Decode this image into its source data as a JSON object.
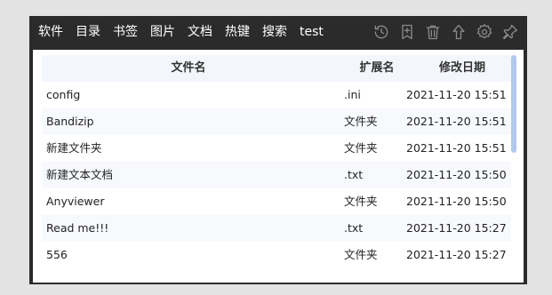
{
  "menu": {
    "items": [
      {
        "label": "软件"
      },
      {
        "label": "目录"
      },
      {
        "label": "书签"
      },
      {
        "label": "图片"
      },
      {
        "label": "文档"
      },
      {
        "label": "热键"
      },
      {
        "label": "搜索"
      },
      {
        "label": "test"
      }
    ]
  },
  "toolbar": {
    "icons": [
      "history-icon",
      "bookmark-add-icon",
      "trash-icon",
      "up-arrow-icon",
      "gear-icon",
      "pin-icon"
    ],
    "icon_color": "#8a8a8a"
  },
  "table": {
    "headers": {
      "name": "文件名",
      "ext": "扩展名",
      "date": "修改日期"
    },
    "rows": [
      {
        "name": "config",
        "ext": ".ini",
        "date": "2021-11-20 15:51"
      },
      {
        "name": "Bandizip",
        "ext": "文件夹",
        "date": "2021-11-20 15:51"
      },
      {
        "name": "新建文件夹",
        "ext": "文件夹",
        "date": "2021-11-20 15:51"
      },
      {
        "name": "新建文本文档",
        "ext": ".txt",
        "date": "2021-11-20 15:50"
      },
      {
        "name": "Anyviewer",
        "ext": "文件夹",
        "date": "2021-11-20 15:50"
      },
      {
        "name": "Read me!!!",
        "ext": ".txt",
        "date": "2021-11-20 15:27"
      },
      {
        "name": "556",
        "ext": "文件夹",
        "date": "2021-11-20 15:27"
      }
    ]
  },
  "colors": {
    "window_bg": "#2b2b2b",
    "header_bg": "#f3f6fc",
    "row_alt_bg": "#f7f9fd",
    "scrollbar": "#b3c8ee"
  }
}
